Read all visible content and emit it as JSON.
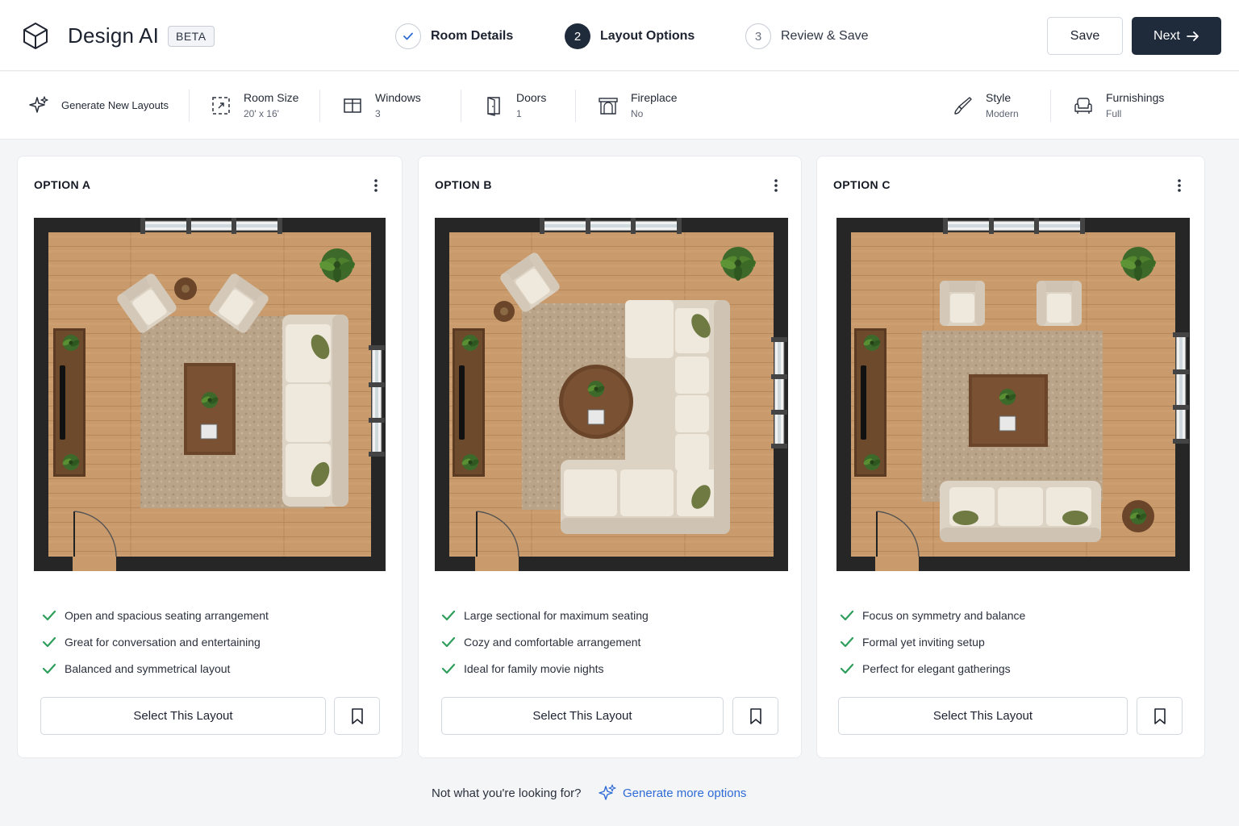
{
  "app": {
    "name": "Design AI",
    "badge": "BETA"
  },
  "steps": [
    {
      "label": "Room Details",
      "number": "",
      "state": "done"
    },
    {
      "label": "Layout Options",
      "number": "2",
      "state": "active"
    },
    {
      "label": "Review & Save",
      "number": "3",
      "state": "pending"
    }
  ],
  "header": {
    "save_label": "Save",
    "next_label": "Next"
  },
  "toolbar": {
    "generate_label": "Generate New Layouts",
    "room_size": {
      "label": "Room Size",
      "value": "20' x 16'"
    },
    "windows": {
      "label": "Windows",
      "value": "3"
    },
    "doors": {
      "label": "Doors",
      "value": "1"
    },
    "fireplace": {
      "label": "Fireplace",
      "value": "No"
    },
    "style": {
      "label": "Style",
      "value": "Modern"
    },
    "furnishings": {
      "label": "Furnishings",
      "value": "Full"
    }
  },
  "options": [
    {
      "title": "OPTION A",
      "features": [
        "Open and spacious seating arrangement",
        "Great for conversation and entertaining",
        "Balanced and symmetrical layout"
      ],
      "select_label": "Select This Layout"
    },
    {
      "title": "OPTION B",
      "features": [
        "Large sectional for maximum seating",
        "Cozy and comfortable arrangement",
        "Ideal for family movie nights"
      ],
      "select_label": "Select This Layout"
    },
    {
      "title": "OPTION C",
      "features": [
        "Focus on symmetry and balance",
        "Formal yet inviting setup",
        "Perfect for elegant gatherings"
      ],
      "select_label": "Select This Layout"
    }
  ],
  "footer": {
    "prompt": "Not what you're looking for?",
    "link_label": "Generate more options"
  },
  "colors": {
    "primary": "#1f2a3a",
    "accent_check": "#2e9e5b",
    "link": "#2f6bd6",
    "floor": "#c99a6b",
    "wall": "#262626",
    "rug": "#b9a48a",
    "upholstery": "#ebe3d6",
    "wood": "#6b4529",
    "plant": "#3f6b2c"
  }
}
